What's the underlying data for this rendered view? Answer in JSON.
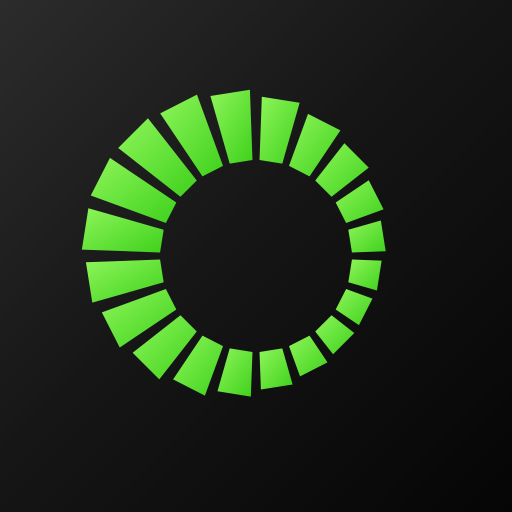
{
  "icon": {
    "name": "loading-spinner-icon",
    "segment_count": 20,
    "colors": {
      "background_light": "#2c2c2c",
      "background_dark": "#050505",
      "segment_light": "#8ef55a",
      "segment_dark": "#3fd11c"
    }
  }
}
